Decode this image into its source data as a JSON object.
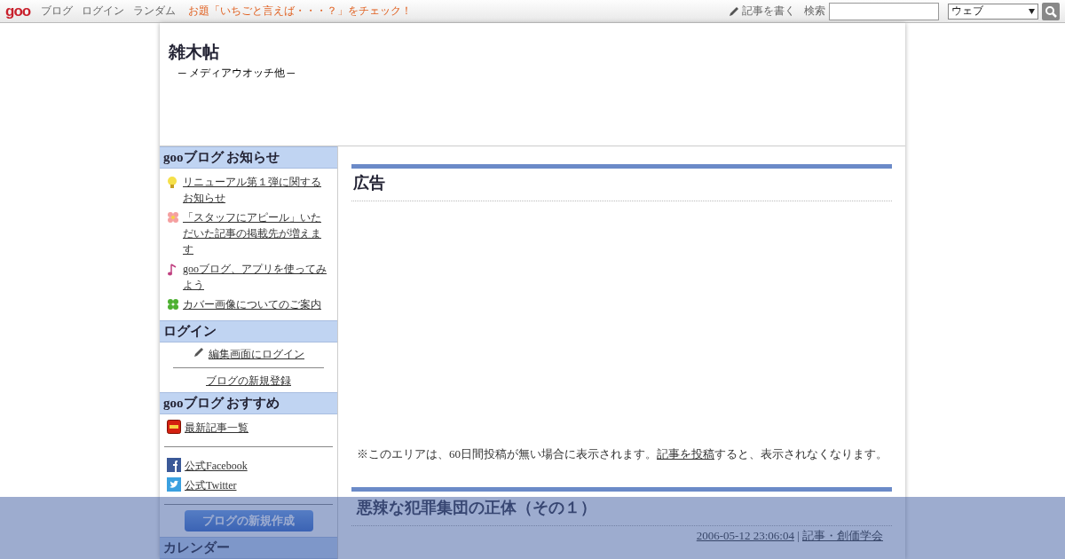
{
  "top_bar": {
    "logo": "goo",
    "links": [
      "ブログ",
      "ログイン",
      "ランダム"
    ],
    "promo": "お題「いちごと言えば・・・？」をチェック！",
    "write_link": "記事を書く",
    "search_label": "検索",
    "search_scope": "ウェブ"
  },
  "blog": {
    "title": "雑木帖",
    "subtitle": "─ メディアウオッチ他 ─"
  },
  "sidebar": {
    "sections": [
      {
        "kind": "news",
        "title": "gooブログ お知らせ",
        "items": [
          {
            "text": "リニューアル第１弾に関するお知らせ"
          },
          {
            "text": "「スタッフにアピール」いただいた記事の掲載先が増えます"
          },
          {
            "text": "gooブログ、アプリを使ってみよう"
          },
          {
            "text": "カバー画像についてのご案内"
          }
        ]
      },
      {
        "kind": "login",
        "title": "ログイン",
        "login_link": "編集画面にログイン",
        "register_link": "ブログの新規登録"
      },
      {
        "kind": "recommend",
        "title": "gooブログ おすすめ",
        "items": [
          {
            "text": "最新記事一覧"
          }
        ],
        "social": [
          {
            "text": "公式Facebook"
          },
          {
            "text": "公式Twitter"
          }
        ],
        "button": "ブログの新規作成"
      },
      {
        "kind": "plain",
        "title": "カレンダー"
      }
    ]
  },
  "main": {
    "ad": {
      "heading": "広告",
      "notice_before": "※このエリアは、60日間投稿が無い場合に表示されます。",
      "notice_link": "記事を投稿",
      "notice_after": "すると、表示されなくなります。"
    },
    "post": {
      "title": "悪辣な犯罪集団の正体（その１）",
      "date": "2006-05-12 23:06:04",
      "separator": "|",
      "category": "記事・創価学会"
    }
  }
}
